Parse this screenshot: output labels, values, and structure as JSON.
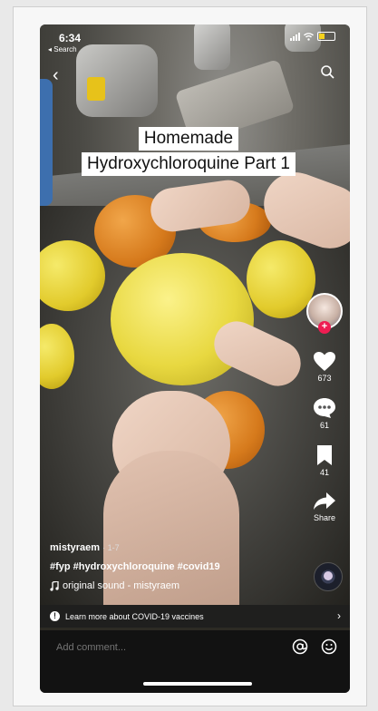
{
  "status_bar": {
    "time": "6:34",
    "back_app": "◂ Search"
  },
  "video": {
    "title_lines": [
      "Homemade",
      "Hydroxychloroquine Part 1"
    ]
  },
  "rail": {
    "likes": "673",
    "comments": "61",
    "saves": "41",
    "share_label": "Share"
  },
  "caption": {
    "username": "mistyraem",
    "date": "· 1-7",
    "hashtags": "#fyp #hydroxychloroquine #covid19",
    "sound": "original sound - mistyraem"
  },
  "covid_banner": {
    "text": "Learn more about COVID-19 vaccines"
  },
  "comment": {
    "placeholder": "Add comment..."
  },
  "colors": {
    "like": "#ffffff",
    "follow_plus": "#ee1d52",
    "comment_bar_bg": "#121212"
  }
}
